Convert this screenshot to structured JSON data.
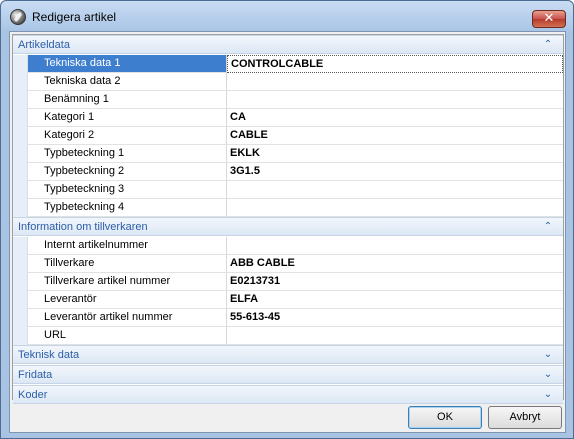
{
  "window": {
    "title": "Redigera artikel",
    "close_glyph": "✕"
  },
  "categories": [
    {
      "label": "Artikeldata",
      "expanded": true,
      "rows": [
        {
          "name": "Tekniska data 1",
          "value": "CONTROLCABLE",
          "selected": true
        },
        {
          "name": "Tekniska data 2",
          "value": ""
        },
        {
          "name": "Benämning 1",
          "value": ""
        },
        {
          "name": "Kategori 1",
          "value": "CA"
        },
        {
          "name": "Kategori 2",
          "value": "CABLE"
        },
        {
          "name": "Typbeteckning 1",
          "value": "EKLK"
        },
        {
          "name": "Typbeteckning 2",
          "value": "3G1.5"
        },
        {
          "name": "Typbeteckning 3",
          "value": ""
        },
        {
          "name": "Typbeteckning 4",
          "value": ""
        }
      ]
    },
    {
      "label": "Information om tillverkaren",
      "expanded": true,
      "rows": [
        {
          "name": "Internt artikelnummer",
          "value": ""
        },
        {
          "name": "Tillverkare",
          "value": "ABB CABLE"
        },
        {
          "name": "Tillverkare artikel nummer",
          "value": "E0213731"
        },
        {
          "name": "Leverantör",
          "value": "ELFA"
        },
        {
          "name": "Leverantör artikel nummer",
          "value": "55-613-45"
        },
        {
          "name": "URL",
          "value": ""
        }
      ]
    },
    {
      "label": "Teknisk data",
      "expanded": false,
      "rows": []
    },
    {
      "label": "Fridata",
      "expanded": false,
      "rows": []
    },
    {
      "label": "Koder",
      "expanded": false,
      "rows": []
    }
  ],
  "icons": {
    "collapse": "⌃",
    "expand": "⌄"
  },
  "buttons": {
    "ok": "OK",
    "cancel": "Avbryt"
  },
  "colors": {
    "selection": "#3d7ecf",
    "category_text": "#2c5ea8"
  }
}
